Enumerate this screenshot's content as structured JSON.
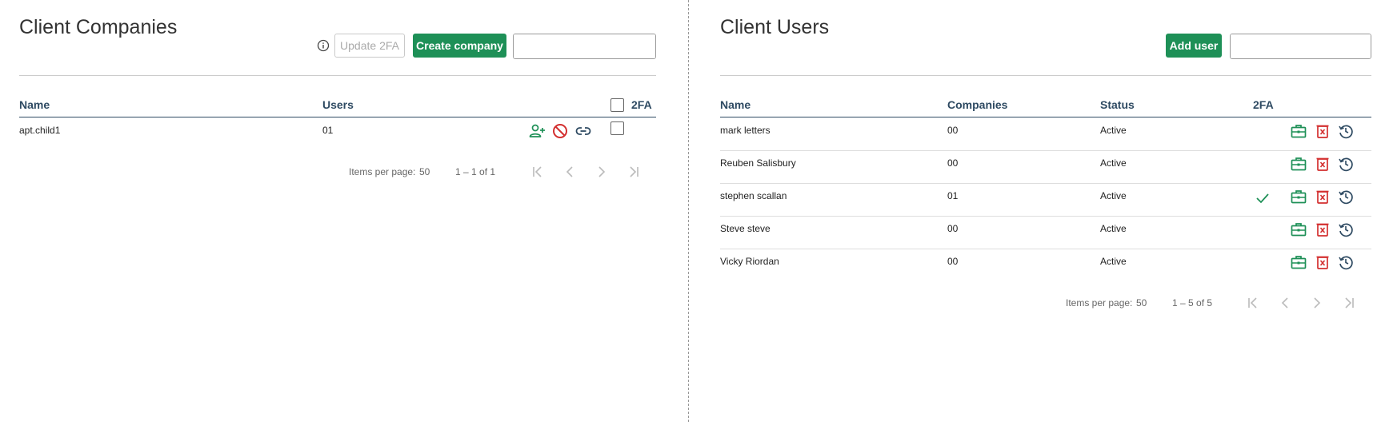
{
  "companies": {
    "title": "Client Companies",
    "update_2fa_label": "Update 2FA",
    "create_label": "Create company",
    "search_placeholder": "",
    "columns": {
      "name": "Name",
      "users": "Users",
      "twofa": "2FA"
    },
    "rows": [
      {
        "name": "apt.child1",
        "users": "01"
      }
    ],
    "pager": {
      "items_label": "Items per page:",
      "items_value": "50",
      "range": "1 – 1 of 1"
    }
  },
  "users": {
    "title": "Client Users",
    "add_label": "Add user",
    "search_placeholder": "",
    "columns": {
      "name": "Name",
      "companies": "Companies",
      "status": "Status",
      "twofa": "2FA"
    },
    "rows": [
      {
        "name": "mark letters",
        "companies": "00",
        "status": "Active",
        "twofa": false
      },
      {
        "name": "Reuben Salisbury",
        "companies": "00",
        "status": "Active",
        "twofa": false
      },
      {
        "name": "stephen scallan",
        "companies": "01",
        "status": "Active",
        "twofa": true
      },
      {
        "name": "Steve steve",
        "companies": "00",
        "status": "Active",
        "twofa": false
      },
      {
        "name": "Vicky Riordan",
        "companies": "00",
        "status": "Active",
        "twofa": false
      }
    ],
    "pager": {
      "items_label": "Items per page:",
      "items_value": "50",
      "range": "1 – 5 of 5"
    }
  },
  "colors": {
    "primary": "#1e9057",
    "danger": "#d32f2f",
    "header": "#2e4a62",
    "icon_dark": "#2e4a62"
  },
  "icons": [
    "info-icon",
    "search-icon",
    "add-user-icon",
    "block-icon",
    "link-icon",
    "check-icon",
    "briefcase-icon",
    "delete-icon",
    "history-icon",
    "first-page-icon",
    "prev-page-icon",
    "next-page-icon",
    "last-page-icon"
  ]
}
